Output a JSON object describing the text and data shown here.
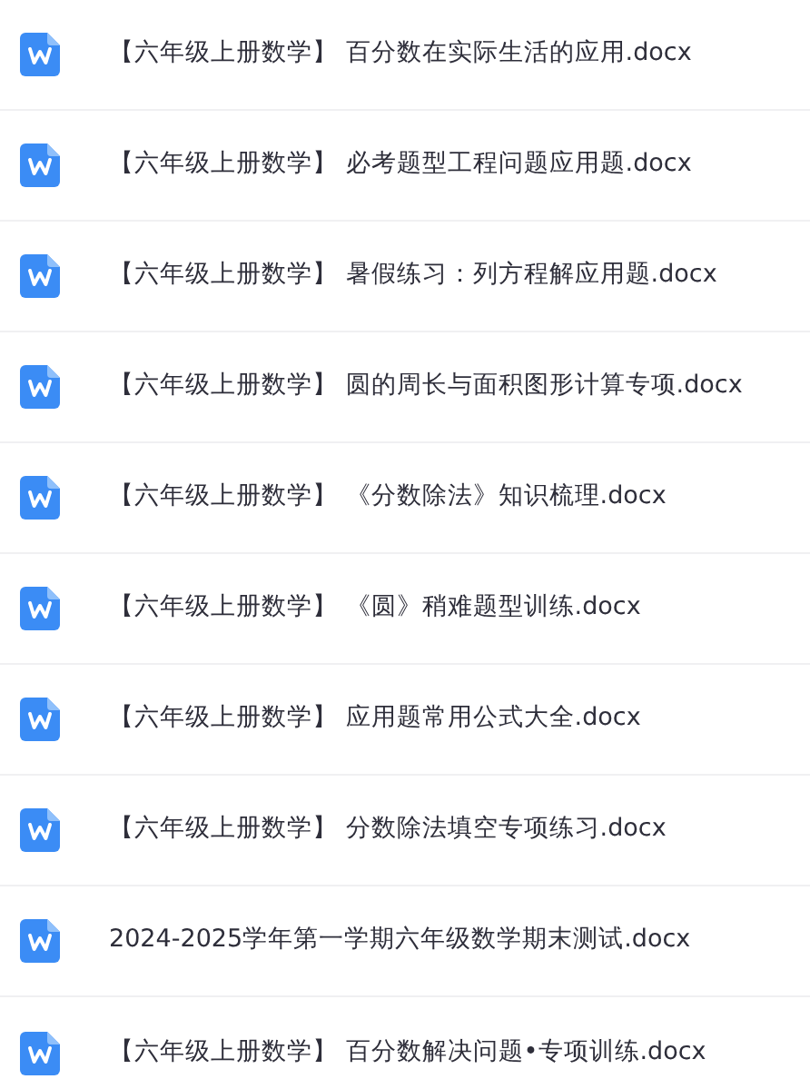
{
  "files": [
    {
      "name": "【六年级上册数学】 百分数在实际生活的应用.docx"
    },
    {
      "name": "【六年级上册数学】 必考题型工程问题应用题.docx"
    },
    {
      "name": "【六年级上册数学】 暑假练习：列方程解应用题.docx"
    },
    {
      "name": "【六年级上册数学】 圆的周长与面积图形计算专项.docx"
    },
    {
      "name": "【六年级上册数学】 《分数除法》知识梳理.docx"
    },
    {
      "name": "【六年级上册数学】 《圆》稍难题型训练.docx"
    },
    {
      "name": "【六年级上册数学】 应用题常用公式大全.docx"
    },
    {
      "name": "【六年级上册数学】 分数除法填空专项练习.docx"
    },
    {
      "name": "2024-2025学年第一学期六年级数学期末测试.docx"
    },
    {
      "name": "【六年级上册数学】 百分数解决问题•专项训练.docx"
    }
  ]
}
